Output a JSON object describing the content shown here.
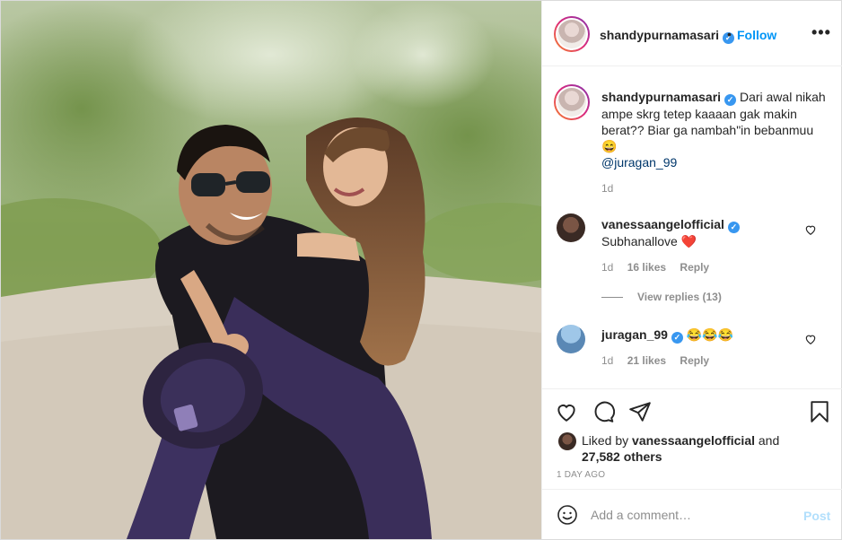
{
  "post": {
    "header": {
      "username": "shandypurnamasari",
      "verified_icon": "verified-badge-icon",
      "separator": "•",
      "follow_label": "Follow",
      "more_label": "•••"
    },
    "caption": {
      "username": "shandypurnamasari",
      "text": "Dari awal nikah ampe skrg tetep kaaaan gak makin berat?? Biar ga nambah\"in bebanmuu 😄",
      "mention": "@juragan_99",
      "time": "1d"
    },
    "comments": [
      {
        "username": "vanessaangelofficial",
        "text": "Subhanallove ❤️",
        "time": "1d",
        "likes": "16 likes",
        "reply_label": "Reply",
        "view_replies": "View replies (13)"
      },
      {
        "username": "juragan_99",
        "text": "😂😂😂",
        "time": "1d",
        "likes": "21 likes",
        "reply_label": "Reply"
      }
    ],
    "actions": {
      "icons": [
        "heart-icon",
        "comment-icon",
        "share-icon",
        "bookmark-icon"
      ]
    },
    "likes": {
      "prefix": "Liked by",
      "liker": "vanessaangelofficial",
      "conjunction": "and",
      "others": "27,582 others",
      "date": "1 DAY AGO"
    },
    "add_comment": {
      "placeholder": "Add a comment…",
      "post_label": "Post"
    },
    "colors": {
      "accent": "#0095f6",
      "verified": "#3897f0",
      "muted": "#8e8e8e",
      "post_disabled": "#b2dffc",
      "heart_red": "#ed4956"
    }
  }
}
